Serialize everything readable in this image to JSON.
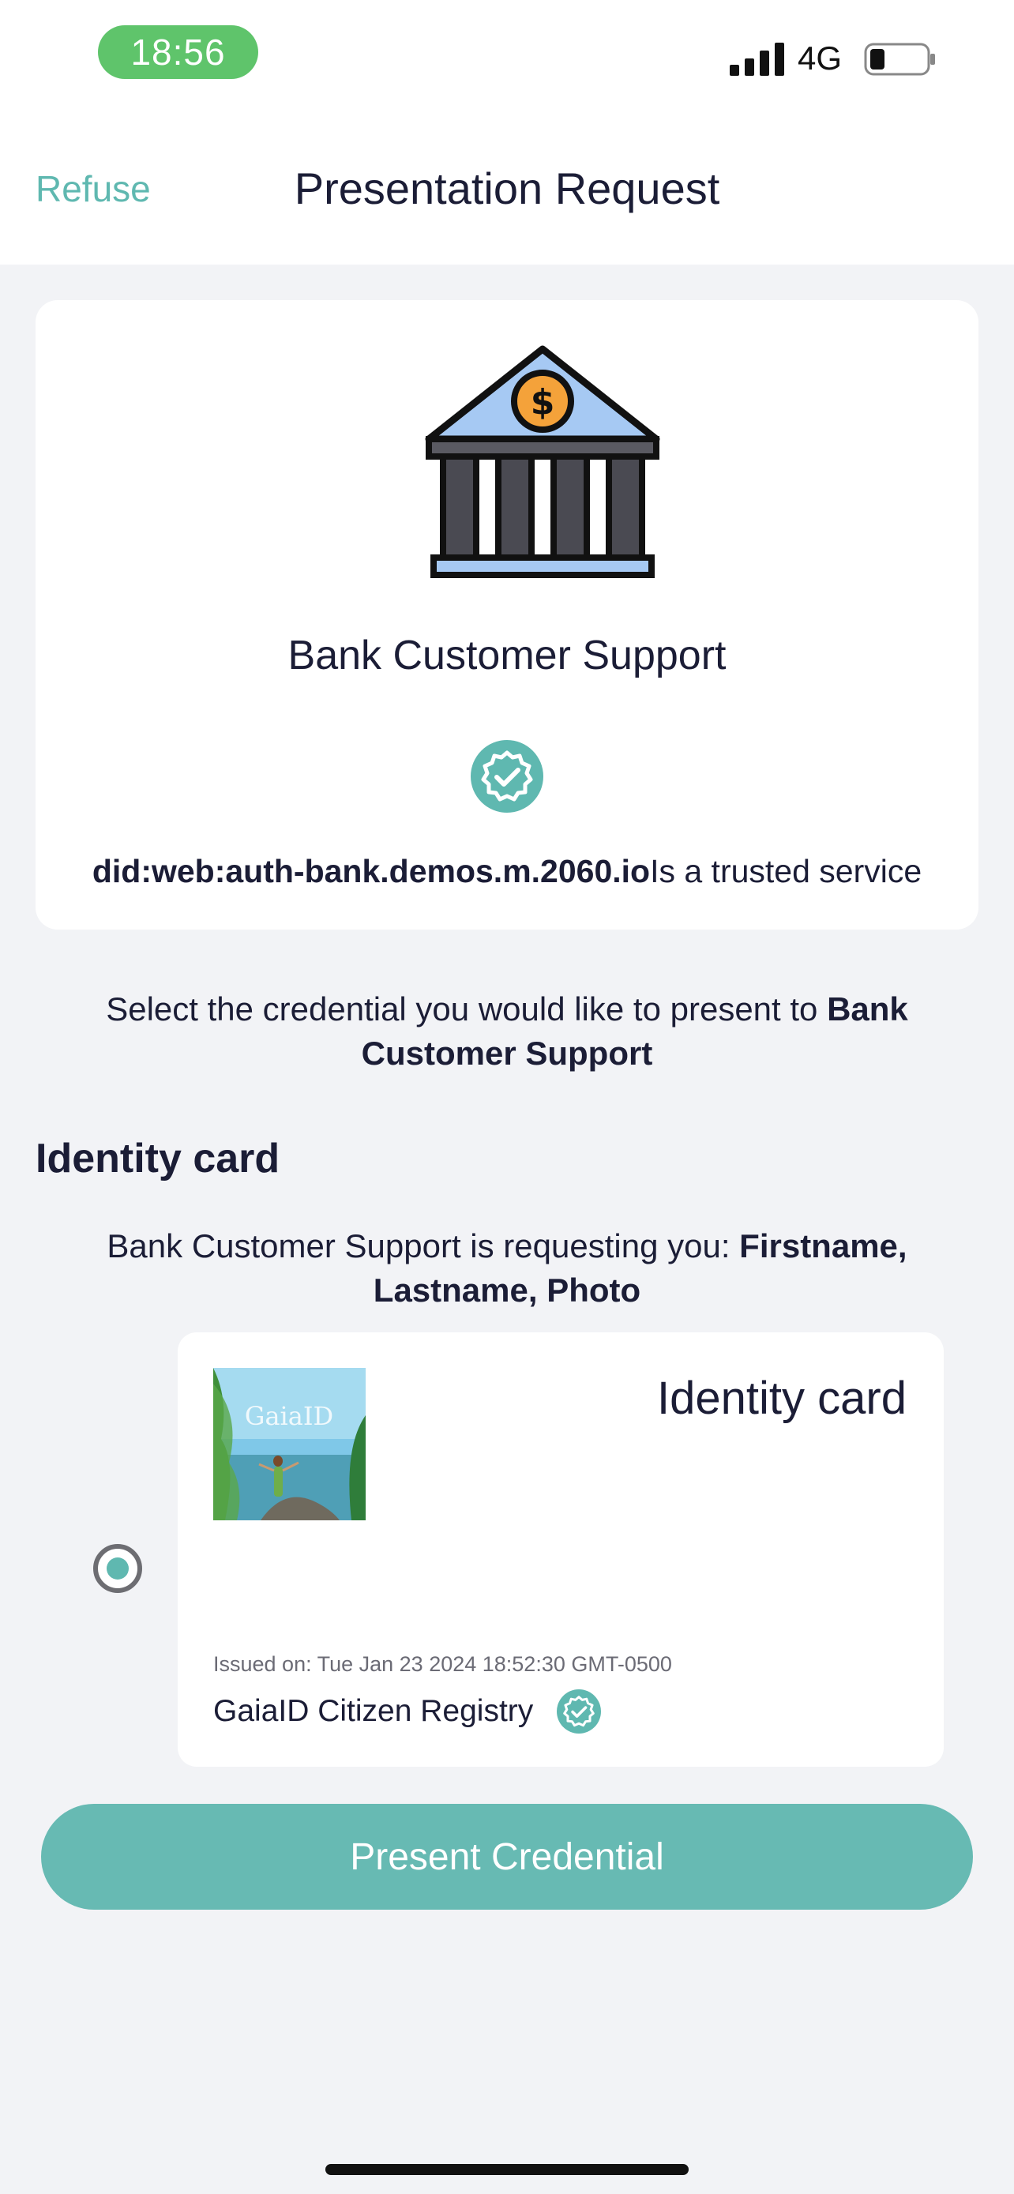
{
  "status_bar": {
    "time": "18:56",
    "network": "4G",
    "icons": [
      "signal-icon",
      "battery-icon"
    ]
  },
  "nav": {
    "refuse_label": "Refuse",
    "title": "Presentation Request"
  },
  "issuer": {
    "icon": "bank-icon",
    "name": "Bank Customer Support",
    "verified_icon": "verified-badge-icon",
    "did": "did:web:auth-bank.demos.m.2060.io",
    "trust_text": "Is a trusted service"
  },
  "selection_prompt": {
    "text": "Select the credential you would like to present to ",
    "recipient": "Bank Customer Support"
  },
  "credential_section": {
    "title": "Identity card",
    "request_prefix": "Bank Customer Support is requesting you: ",
    "requested_fields": "Firstname, Lastname, Photo"
  },
  "credential_card": {
    "selected": true,
    "photo_caption": "GaiaID",
    "title": "Identity card",
    "issued_on": "Issued on: Tue Jan 23 2024 18:52:30 GMT-0500",
    "issuer": "GaiaID Citizen Registry"
  },
  "actions": {
    "present_label": "Present Credential"
  },
  "colors": {
    "accent": "#5fb8b0",
    "button": "#67bab3",
    "status_time_pill": "#5fc46b",
    "background": "#f2f3f6",
    "text": "#1b1d36"
  }
}
